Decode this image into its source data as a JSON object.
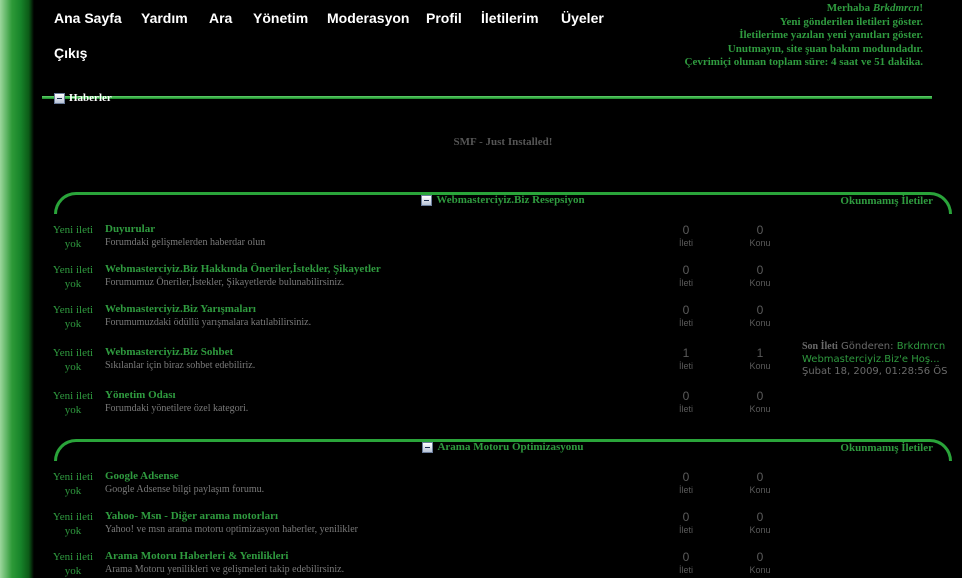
{
  "menu": [
    {
      "label": "Ana Sayfa"
    },
    {
      "label": "Yardım"
    },
    {
      "label": "Ara"
    },
    {
      "label": "Yönetim"
    },
    {
      "label": "Moderasyon"
    },
    {
      "label": "Profil"
    },
    {
      "label": "İletilerim"
    },
    {
      "label": "Üyeler"
    },
    {
      "label": "Çıkış"
    }
  ],
  "user": {
    "greeting": "Merhaba",
    "username": "Brkdmrcn",
    "greeting_suffix": "!",
    "line1": "Yeni gönderilen iletileri göster.",
    "line2": "İletilerime yazılan yeni yanıtları göster.",
    "line3": "Unutmayın, site şuan bakım modundadır.",
    "line4": "Çevrimiçi olunan toplam süre: 4 saat ve 51 dakika."
  },
  "news": {
    "title": "Haberler",
    "body": "SMF - Just Installed!"
  },
  "categories": [
    {
      "title": "Webmasterciyiz.Biz Resepsiyon",
      "unread": "Okunmamış İletiler",
      "boards": [
        {
          "status1": "Yeni ileti",
          "status2": "yok",
          "name": "Duyurular",
          "desc": "Forumdaki gelişmelerden haberdar olun",
          "posts": "0",
          "posts_label": "İleti",
          "topics": "0",
          "topics_label": "Konu"
        },
        {
          "status1": "Yeni ileti",
          "status2": "yok",
          "name": "Webmasterciyiz.Biz Hakkında Öneriler,İstekler, Şikayetler",
          "desc": "Forumumuz Öneriler,İstekler, Şikayetlerde bulunabilirsiniz.",
          "posts": "0",
          "posts_label": "İleti",
          "topics": "0",
          "topics_label": "Konu"
        },
        {
          "status1": "Yeni ileti",
          "status2": "yok",
          "name": "Webmasterciyiz.Biz Yarışmaları",
          "desc": "Forumumuzdaki ödüllü yarışmalara katılabilirsiniz.",
          "posts": "0",
          "posts_label": "İleti",
          "topics": "0",
          "topics_label": "Konu"
        },
        {
          "status1": "Yeni ileti",
          "status2": "yok",
          "name": "Webmasterciyiz.Biz Sohbet",
          "desc": "Sıkılanlar için biraz sohbet edebiliriz.",
          "posts": "1",
          "posts_label": "İleti",
          "topics": "1",
          "topics_label": "Konu"
        },
        {
          "status1": "Yeni ileti",
          "status2": "yok",
          "name": "Yönetim Odası",
          "desc": "Forumdaki yönetilere özel kategori.",
          "posts": "0",
          "posts_label": "İleti",
          "topics": "0",
          "topics_label": "Konu"
        }
      ]
    },
    {
      "title": "Arama Motoru Optimizasyonu",
      "unread": "Okunmamış İletiler",
      "boards": [
        {
          "status1": "Yeni ileti",
          "status2": "yok",
          "name": "Google Adsense",
          "desc": "Google Adsense bilgi paylaşım forumu.",
          "posts": "0",
          "posts_label": "İleti",
          "topics": "0",
          "topics_label": "Konu"
        },
        {
          "status1": "Yeni ileti",
          "status2": "yok",
          "name": "Yahoo- Msn - Diğer arama motorları",
          "desc": "Yahoo! ve msn arama motoru optimizasyon haberler, yenilikler",
          "posts": "0",
          "posts_label": "İleti",
          "topics": "0",
          "topics_label": "Konu"
        },
        {
          "status1": "Yeni ileti",
          "status2": "yok",
          "name": "Arama Motoru Haberleri & Yenilikleri",
          "desc": "Arama Motoru yenilikleri ve gelişmeleri takip edebilirsiniz.",
          "posts": "0",
          "posts_label": "İleti",
          "topics": "0",
          "topics_label": "Konu"
        }
      ]
    }
  ],
  "last_post": {
    "label": "Son İleti",
    "by": "Gönderen:",
    "author": "Brkdmrcn",
    "topic": "Webmasterciyiz.Biz'e Hoş...",
    "date": "Şubat 18, 2009, 01:28:56 ÖS"
  }
}
